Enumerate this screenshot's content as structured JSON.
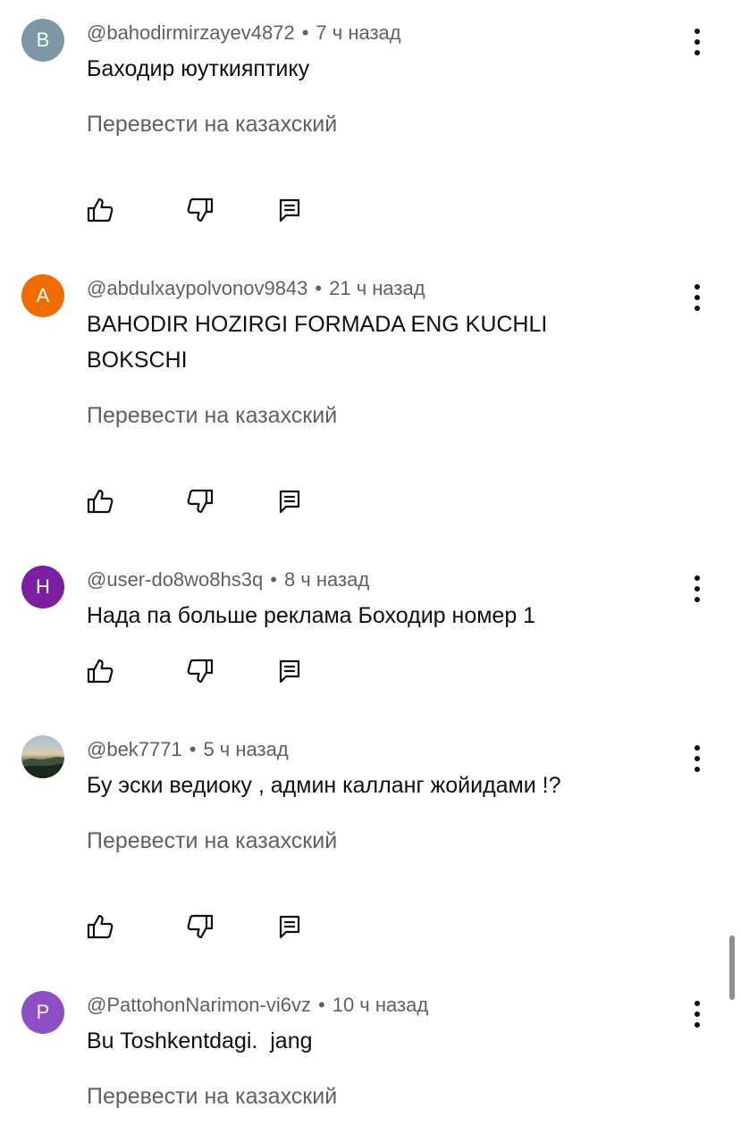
{
  "comments": [
    {
      "avatar_letter": "B",
      "avatar_color": "#7e97a6",
      "author": "@bahodirmirzayev4872",
      "time": "7 ч назад",
      "text": "Баходир юуткияптику",
      "translate_label": "Перевести на казахский"
    },
    {
      "avatar_letter": "A",
      "avatar_color": "#ef6c00",
      "author": "@abdulxaypolvonov9843",
      "time": "21 ч назад",
      "text": "BAHODIR HOZIRGI FORMADA ENG KUCHLI BOKSCHI",
      "translate_label": "Перевести на казахский"
    },
    {
      "avatar_letter": "H",
      "avatar_color": "#7b1fa2",
      "author": "@user-do8wo8hs3q",
      "time": "8 ч назад",
      "text": "Нада па больше реклама Боходир номер 1"
    },
    {
      "avatar_letter": "",
      "avatar_color": "#5b6f58",
      "author": "@bek7771",
      "time": "5 ч назад",
      "text": "Бу эски ведиоку , админ калланг жойидами !?",
      "translate_label": "Перевести на казахский"
    },
    {
      "avatar_letter": "P",
      "avatar_color": "#8e4fc4",
      "author": "@PattohonNarimon-vi6vz",
      "time": "10 ч назад",
      "text": "Bu Toshkentdagi.  jang",
      "translate_label": "Перевести на казахский"
    }
  ],
  "separator": "•",
  "icons": {
    "like": "thumb-up-icon",
    "dislike": "thumb-down-icon",
    "reply": "reply-comment-icon",
    "menu": "more-vert-icon"
  }
}
